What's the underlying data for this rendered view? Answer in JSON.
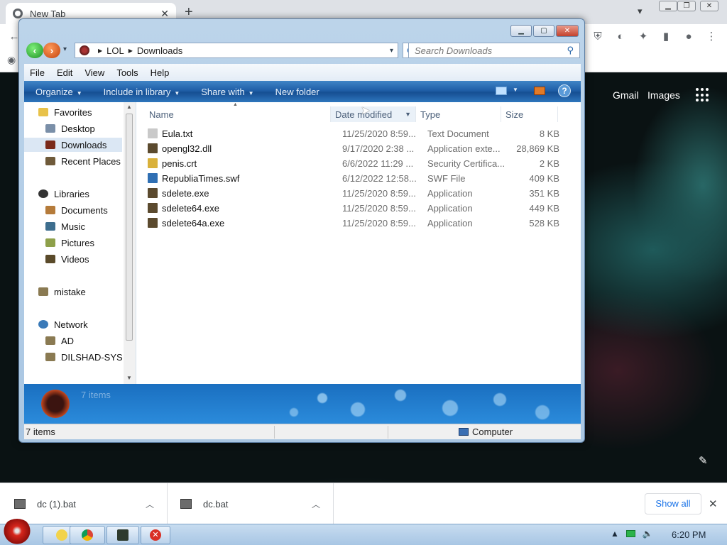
{
  "browser": {
    "tab_title": "New Tab",
    "new_tab": "+",
    "tab_close": "✕",
    "links": {
      "gmail": "Gmail",
      "images": "Images"
    }
  },
  "explorer": {
    "breadcrumb": [
      "LOL",
      "Downloads"
    ],
    "search_placeholder": "Search Downloads",
    "menu": [
      "File",
      "Edit",
      "View",
      "Tools",
      "Help"
    ],
    "commands": [
      "Organize",
      "Include in library",
      "Share with",
      "New folder"
    ],
    "nav": {
      "favorites": {
        "label": "Favorites",
        "items": [
          "Desktop",
          "Downloads",
          "Recent Places"
        ]
      },
      "libraries": {
        "label": "Libraries",
        "items": [
          "Documents",
          "Music",
          "Pictures",
          "Videos"
        ]
      },
      "homegroup": "mistake",
      "network": {
        "label": "Network",
        "items": [
          "AD",
          "DILSHAD-SYS"
        ]
      }
    },
    "columns": {
      "name": "Name",
      "date": "Date modified",
      "type": "Type",
      "size": "Size"
    },
    "files": [
      {
        "name": "Eula.txt",
        "date": "11/25/2020 8:59...",
        "type": "Text Document",
        "size": "8 KB",
        "color": "#c9c9c9"
      },
      {
        "name": "opengl32.dll",
        "date": "9/17/2020 2:38 ...",
        "type": "Application exte...",
        "size": "28,869 KB",
        "color": "#5b4a2e"
      },
      {
        "name": "penis.crt",
        "date": "6/6/2022 11:29 ...",
        "type": "Security Certifica...",
        "size": "2 KB",
        "color": "#d9b13b"
      },
      {
        "name": "RepubliaTimes.swf",
        "date": "6/12/2022 12:58...",
        "type": "SWF File",
        "size": "409 KB",
        "color": "#2f6fb3"
      },
      {
        "name": "sdelete.exe",
        "date": "11/25/2020 8:59...",
        "type": "Application",
        "size": "351 KB",
        "color": "#5b4a2e"
      },
      {
        "name": "sdelete64.exe",
        "date": "11/25/2020 8:59...",
        "type": "Application",
        "size": "449 KB",
        "color": "#5b4a2e"
      },
      {
        "name": "sdelete64a.exe",
        "date": "11/25/2020 8:59...",
        "type": "Application",
        "size": "528 KB",
        "color": "#5b4a2e"
      }
    ],
    "details_count": "7 items",
    "status_count": "7 items",
    "status_location": "Computer"
  },
  "downloads": {
    "items": [
      "dc (1).bat",
      "dc.bat"
    ],
    "show_all": "Show all"
  },
  "taskbar": {
    "time": "6:20 PM"
  }
}
